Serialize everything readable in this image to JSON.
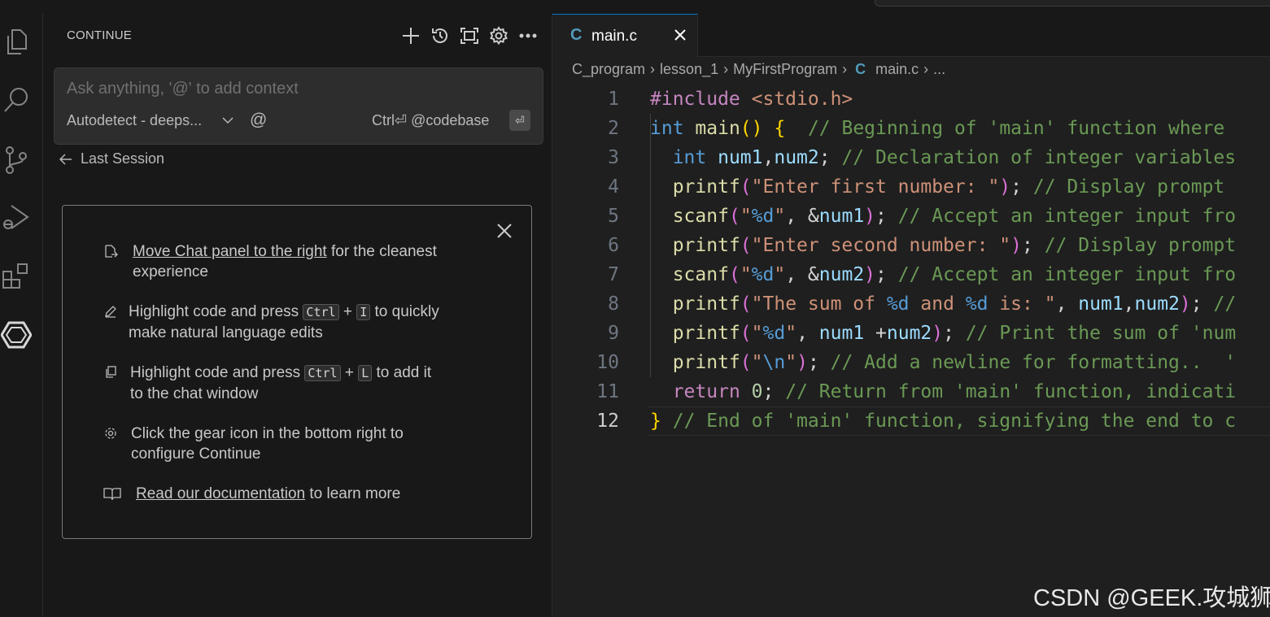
{
  "panel": {
    "title": "CONTINUE",
    "input_placeholder": "Ask anything, '@' to add context",
    "model_selector": "Autodetect - deeps...",
    "at_symbol": "@",
    "context_hint": "Ctrl⏎ @codebase",
    "enter_glyph": "⏎",
    "last_session": "Last Session"
  },
  "tips": {
    "move_link": "Move Chat panel to the right",
    "move_rest1": " for the cleanest",
    "move_rest2": "experience",
    "edit_line1a": "Highlight code and press ",
    "edit_key1": "Ctrl",
    "plus": "+",
    "edit_key2": "I",
    "edit_line1b": " to quickly",
    "edit_line2": "make natural language edits",
    "add_line1a": "Highlight code and press ",
    "add_key1": "Ctrl",
    "add_key2": "L",
    "add_line1b": " to add it",
    "add_line2": "to the chat window",
    "gear_line1": "Click the gear icon in the bottom right to",
    "gear_line2": "configure Continue",
    "docs_link": "Read our documentation",
    "docs_rest": " to learn more"
  },
  "editor": {
    "tab_icon": "C",
    "tab_name": "main.c",
    "breadcrumb": [
      "C_program",
      "lesson_1",
      "MyFirstProgram",
      "main.c",
      "..."
    ],
    "current_line": 12
  },
  "code_lines": [
    "#include <stdio.h>",
    "int main() {  // Beginning of 'main' function where",
    "  int num1,num2; // Declaration of integer variables",
    "  printf(\"Enter first number: \"); // Display prompt",
    "  scanf(\"%d\", &num1); // Accept an integer input fro",
    "  printf(\"Enter second number: \"); // Display prompt",
    "  scanf(\"%d\", &num2); // Accept an integer input fro",
    "  printf(\"The sum of %d and %d is: \", num1,num2); //",
    "  printf(\"%d\", num1 +num2); // Print the sum of 'num",
    "  printf(\"\\n\"); // Add a newline for formatting..  '",
    "  return 0; // Return from 'main' function, indicati",
    "} // End of 'main' function, signifying the end to c"
  ],
  "watermark": "CSDN @GEEK.攻城狮",
  "colors": {
    "keyword": "#569cd6",
    "control": "#c586c0",
    "function": "#dcdcaa",
    "string": "#ce9178",
    "comment": "#6a9955",
    "variable": "#9cdcfe",
    "format": "#569cd6",
    "number": "#b5cea8",
    "bracket1": "#ffd700",
    "bracket2": "#da70d6"
  }
}
